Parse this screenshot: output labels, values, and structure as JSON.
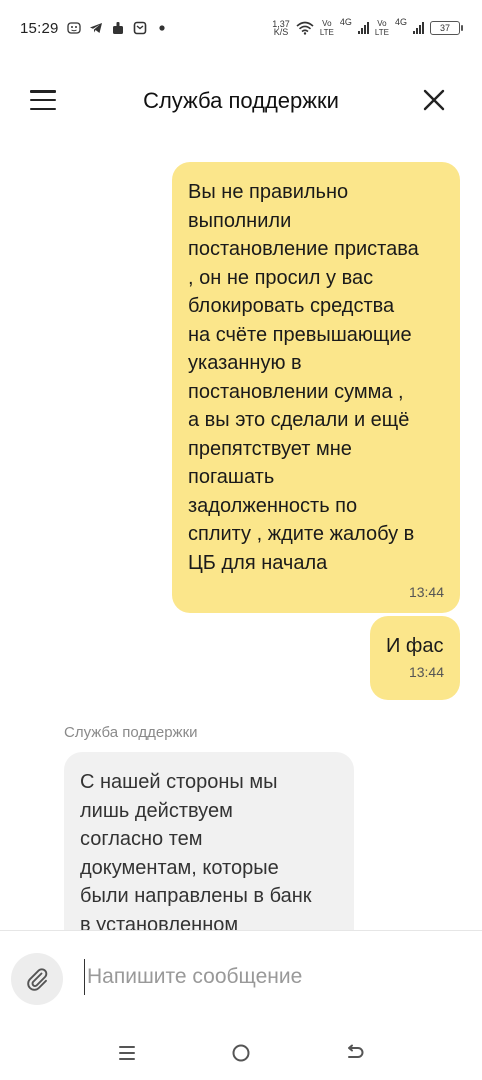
{
  "status_bar": {
    "time": "15:29",
    "speed_value": "1,37",
    "speed_unit": "K/S",
    "net1_top": "Vo",
    "net1_bottom": "LTE",
    "net1_gen": "4G",
    "net2_top": "Vo",
    "net2_bottom": "LTE",
    "net2_gen": "4G",
    "battery": "37",
    "icons": [
      "face-id-icon",
      "telegram-icon",
      "app-icon",
      "message-icon",
      "dot-icon",
      "wifi-icon"
    ]
  },
  "header": {
    "title": "Служба поддержки",
    "menu_icon": "hamburger-menu-icon",
    "close_icon": "close-icon"
  },
  "chat": {
    "messages": [
      {
        "direction": "out",
        "lines": [
          "Вы не правильно",
          "выполнили",
          "постановление пристава",
          ", он не просил у вас",
          "блокировать средства",
          "на счёте превышающие",
          "указанную в",
          "постановлении сумма ,",
          "а вы это сделали и ещё",
          "препятствует мне",
          "погашать",
          "задолженность по",
          "сплиту , ждите жалобу в",
          "ЦБ для начала"
        ],
        "time": "13:44"
      },
      {
        "direction": "out",
        "lines": [
          "И фас"
        ],
        "time": "13:44"
      },
      {
        "direction": "in",
        "sender": "Служба поддержки",
        "lines": [
          "С нашей стороны мы",
          "лишь действуем",
          "согласно тем",
          "документам, которые",
          "были направлены в банк",
          "в установленном"
        ]
      }
    ]
  },
  "composer": {
    "placeholder": "Напишите сообщение",
    "value": "",
    "attach_icon": "paperclip-icon"
  },
  "nav_bar": {
    "icons": [
      "recent-apps-icon",
      "home-icon",
      "back-icon"
    ]
  },
  "colors": {
    "outgoing_bubble": "#fbe68b",
    "incoming_bubble": "#f1f1f1",
    "sender_name": "#8a8a8a",
    "placeholder": "#999999"
  }
}
